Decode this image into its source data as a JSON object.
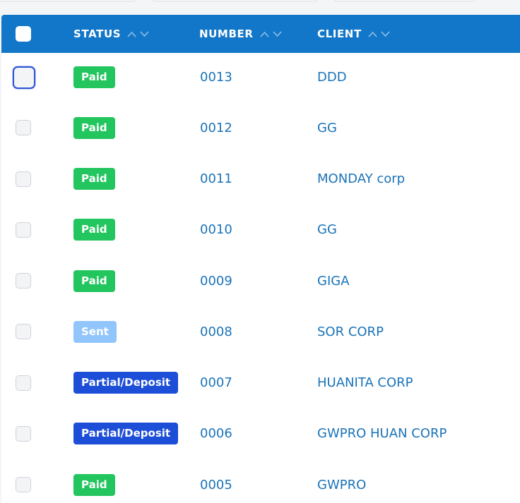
{
  "header": {
    "select_all_checked": false,
    "columns": [
      {
        "key": "status",
        "label": "STATUS",
        "sortable": true
      },
      {
        "key": "number",
        "label": "NUMBER",
        "sortable": true
      },
      {
        "key": "client",
        "label": "CLIENT",
        "sortable": true
      }
    ]
  },
  "status_colors": {
    "Paid": "#22c55e",
    "Sent": "#93c5fd",
    "Partial/Deposit": "#1d4ed8"
  },
  "colors": {
    "header_bg": "#1377c9",
    "link": "#1a73b8",
    "focus_ring": "#2f55d4"
  },
  "rows": [
    {
      "status": "Paid",
      "number": "0013",
      "client": "DDD",
      "focused": true
    },
    {
      "status": "Paid",
      "number": "0012",
      "client": "GG"
    },
    {
      "status": "Paid",
      "number": "0011",
      "client": "MONDAY corp"
    },
    {
      "status": "Paid",
      "number": "0010",
      "client": "GG"
    },
    {
      "status": "Paid",
      "number": "0009",
      "client": "GIGA"
    },
    {
      "status": "Sent",
      "number": "0008",
      "client": "SOR CORP"
    },
    {
      "status": "Partial/Deposit",
      "number": "0007",
      "client": "HUANITA CORP"
    },
    {
      "status": "Partial/Deposit",
      "number": "0006",
      "client": "GWPRO HUAN CORP"
    },
    {
      "status": "Paid",
      "number": "0005",
      "client": "GWPRO"
    }
  ]
}
